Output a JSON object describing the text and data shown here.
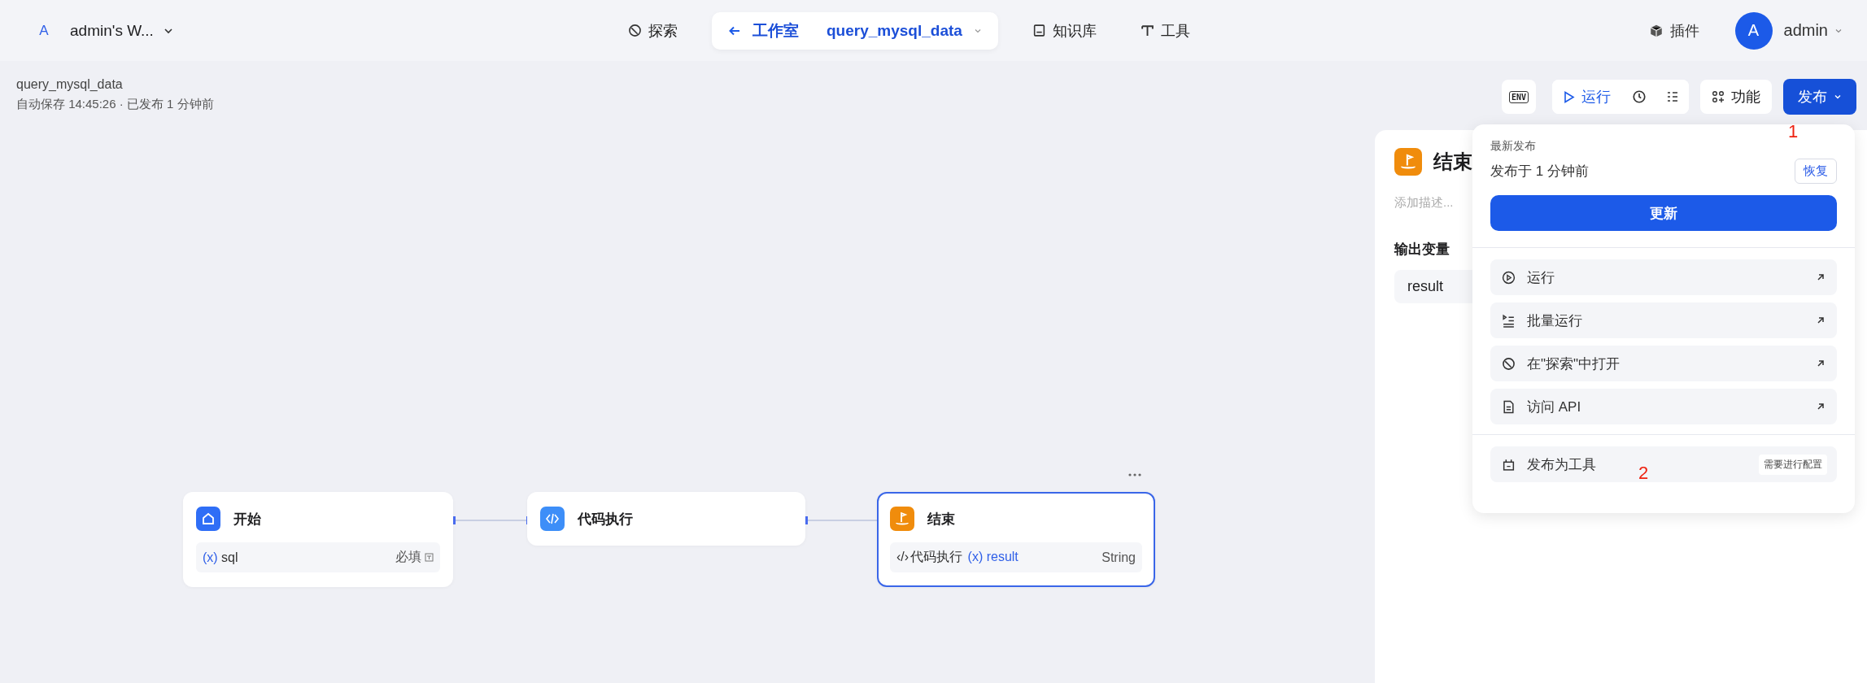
{
  "workspace": {
    "avatar": "A",
    "name": "admin's W..."
  },
  "nav": [
    {
      "kind": "explore",
      "label": "探索",
      "selected": false
    },
    {
      "kind": "studio",
      "label": "工作室",
      "app_name": "query_mysql_data",
      "selected": true
    },
    {
      "kind": "knowledge",
      "label": "知识库",
      "selected": false
    },
    {
      "kind": "tools",
      "label": "工具",
      "selected": false
    }
  ],
  "plugins": "插件",
  "user": {
    "avatar": "A",
    "name": "admin"
  },
  "app": {
    "name": "query_mysql_data",
    "status": "自动保存 14:45:26 · 已发布 1 分钟前"
  },
  "toolbar": {
    "env": "ENV",
    "run": "运行",
    "features": "功能",
    "publish": "发布",
    "publish_expanded": true
  },
  "end_panel": {
    "title": "结束",
    "description_placeholder": "添加描述...",
    "section": "输出变量",
    "variables": [
      "result"
    ]
  },
  "publish_menu": {
    "heading": "最新发布",
    "published": "发布于 1 分钟前",
    "restore": "恢复",
    "update": "更新",
    "actions": [
      {
        "kind": "run",
        "label": "运行"
      },
      {
        "kind": "batch",
        "label": "批量运行"
      },
      {
        "kind": "explore",
        "label": "在\"探索\"中打开"
      },
      {
        "kind": "api",
        "label": "访问 API"
      }
    ],
    "tool": {
      "label": "发布为工具",
      "badge": "需要进行配置"
    }
  },
  "annotations": [
    "1",
    "2"
  ],
  "nodes": [
    {
      "kind": "start",
      "title": "开始",
      "selected": false,
      "fields": [
        {
          "icon": "(x)",
          "name": "sql",
          "tag": "必填"
        }
      ]
    },
    {
      "kind": "code",
      "title": "代码执行",
      "selected": false
    },
    {
      "kind": "end",
      "title": "结束",
      "selected": true,
      "outputs": [
        {
          "source_icon": "‹/›",
          "source": "代码执行",
          "icon": "(x)",
          "name": "result",
          "type": "String"
        }
      ]
    }
  ]
}
